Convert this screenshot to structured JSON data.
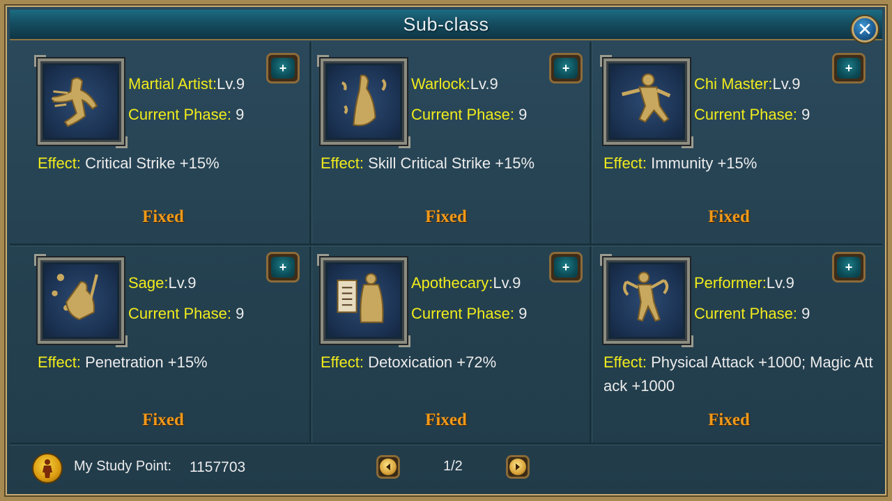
{
  "window": {
    "title": "Sub-class"
  },
  "icons": {
    "close": "close-icon",
    "plus": "plus-icon",
    "prev": "arrow-left-icon",
    "next": "arrow-right-icon",
    "study": "study-point-icon"
  },
  "classes": [
    {
      "name": "Martial Artist:",
      "level": "Lv.9",
      "phase_label": "Current Phase:",
      "phase": "9",
      "effect_label": "Effect:",
      "effect": "Critical Strike +15%",
      "status": "Fixed",
      "plus_label": "+"
    },
    {
      "name": "Warlock:",
      "level": "Lv.9",
      "phase_label": "Current Phase:",
      "phase": "9",
      "effect_label": "Effect:",
      "effect": "Skill Critical Strike +15%",
      "status": "Fixed",
      "plus_label": "+"
    },
    {
      "name": "Chi Master:",
      "level": "Lv.9",
      "phase_label": "Current Phase:",
      "phase": "9",
      "effect_label": "Effect:",
      "effect": "Immunity +15%",
      "status": "Fixed",
      "plus_label": "+"
    },
    {
      "name": "Sage:",
      "level": "Lv.9",
      "phase_label": "Current Phase:",
      "phase": "9",
      "effect_label": "Effect:",
      "effect": "Penetration +15%",
      "status": "Fixed",
      "plus_label": "+"
    },
    {
      "name": "Apothecary:",
      "level": "Lv.9",
      "phase_label": "Current Phase:",
      "phase": "9",
      "effect_label": "Effect:",
      "effect": "Detoxication +72%",
      "status": "Fixed",
      "plus_label": "+"
    },
    {
      "name": "Performer:",
      "level": "Lv.9",
      "phase_label": "Current Phase:",
      "phase": "9",
      "effect_label": "Effect:",
      "effect": "Physical Attack +1000; Magic Attack +1000",
      "status": "Fixed",
      "plus_label": "+"
    }
  ],
  "footer": {
    "study_label": "My Study Point:",
    "study_value": "1157703",
    "page": "1/2"
  },
  "colors": {
    "label_yellow": "#f2ec1c",
    "fixed_orange": "#f09a1a",
    "panel_bg": "#24404f",
    "frame_gold": "#a78a52"
  }
}
